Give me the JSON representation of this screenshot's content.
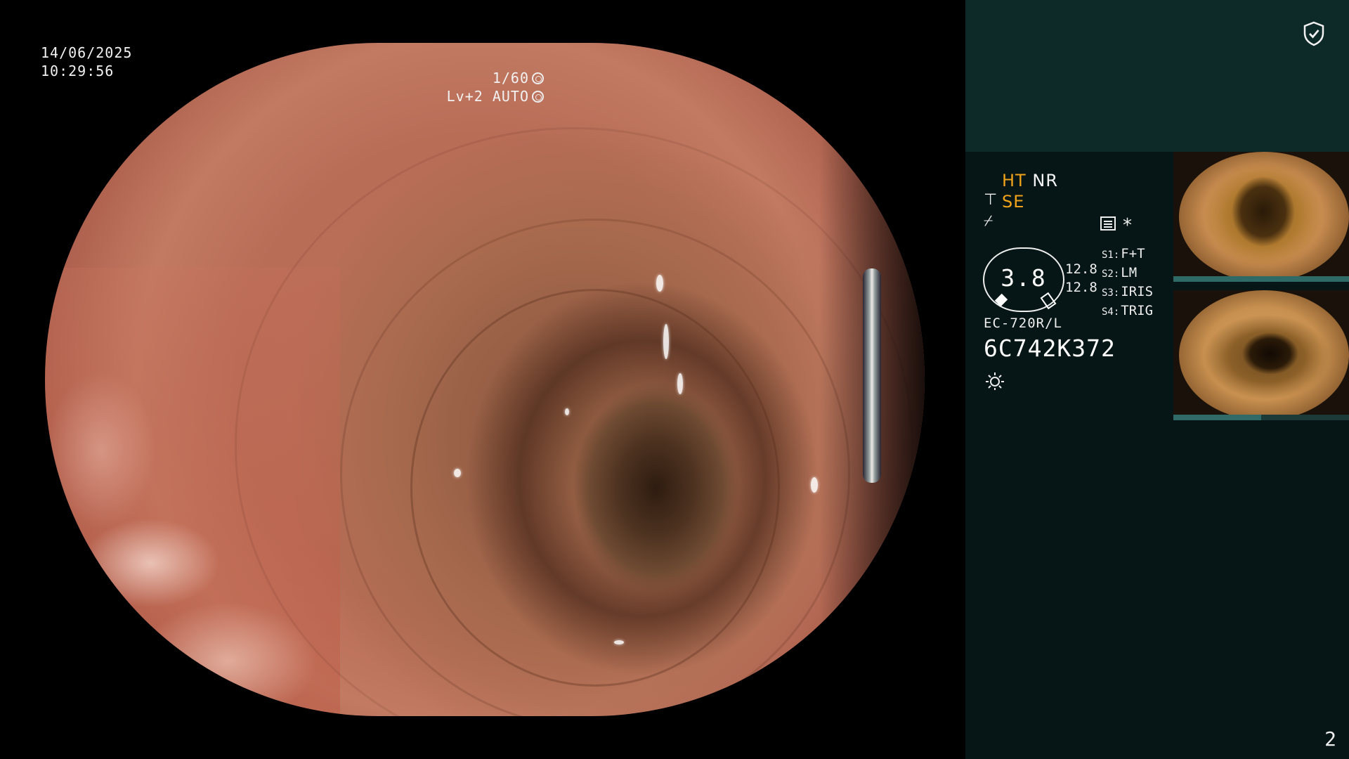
{
  "overlay": {
    "date": "14/06/2025",
    "time": "10:29:56",
    "shutter": "1/60",
    "level": "Lv+2 AUTO"
  },
  "panel": {
    "mode_ht": "HT",
    "mode_nr": "NR",
    "mode_se": "SE",
    "dial_value": "3.8",
    "gain_top": "12.8",
    "gain_bottom": "12.8",
    "settings": [
      {
        "key": "S1:",
        "value": "F+T"
      },
      {
        "key": "S2:",
        "value": "LM"
      },
      {
        "key": "S3:",
        "value": "IRIS"
      },
      {
        "key": "S4:",
        "value": "TRIG"
      }
    ],
    "scope_model": "EC-720R/L",
    "scope_serial": "6C742K372",
    "page_number": "2"
  },
  "thumbnails": [
    {
      "label": "captured-image-1",
      "serial": "6C742K372",
      "progress": 1.0
    },
    {
      "label": "captured-image-2",
      "serial": "6C742K372",
      "progress": 0.5
    }
  ],
  "icons": {
    "shield": "shield-check-icon",
    "light": "light-source-icon",
    "menu": "menu-list-icon",
    "asterisk": "asterisk-icon"
  },
  "colors": {
    "panel_bg": "#061616",
    "panel_top_bg": "#0d2a29",
    "accent": "#f0a21a"
  }
}
